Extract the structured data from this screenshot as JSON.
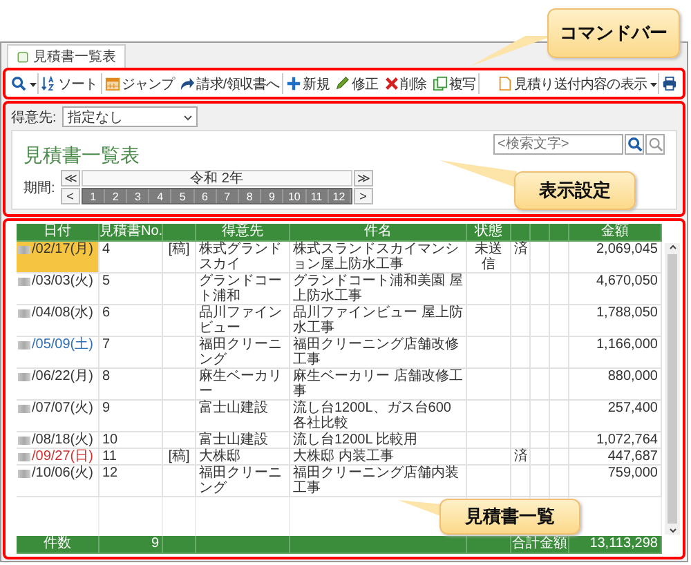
{
  "tab": {
    "label": "見積書一覧表",
    "selected": true
  },
  "toolbar": {
    "items": [
      {
        "kind": "search"
      },
      {
        "kind": "sort",
        "label": "ソート"
      },
      {
        "kind": "jump",
        "label": "ジャンプ"
      },
      {
        "kind": "forward",
        "label": "請求/領収書へ"
      },
      {
        "kind": "new",
        "label": "新規"
      },
      {
        "kind": "edit",
        "label": "修正"
      },
      {
        "kind": "delete",
        "label": "削除"
      },
      {
        "kind": "copy",
        "label": "複写"
      }
    ],
    "preview": {
      "label": "見積り送付内容の表示"
    }
  },
  "filter": {
    "label": "得意先:",
    "value": "指定なし"
  },
  "title": "見積書一覧表",
  "search": {
    "placeholder": "<検索文字>"
  },
  "period": {
    "label": "期間:",
    "first": "≪",
    "last": "≫",
    "prev": "<",
    "next": ">",
    "year": "令和 2年",
    "months": [
      {
        "label": "1",
        "selected": false
      },
      {
        "label": "2",
        "selected": false
      },
      {
        "label": "3",
        "selected": false
      },
      {
        "label": "4",
        "selected": false
      },
      {
        "label": "5",
        "selected": false
      },
      {
        "label": "6",
        "selected": false
      },
      {
        "label": "7",
        "selected": false
      },
      {
        "label": "8",
        "selected": false
      },
      {
        "label": "9",
        "selected": false
      },
      {
        "label": "10",
        "selected": false
      },
      {
        "label": "11",
        "selected": false
      },
      {
        "label": "12",
        "selected": false
      }
    ]
  },
  "table": {
    "columns": [
      "日付",
      "見積書No.",
      null,
      "得意先",
      "件名",
      "状態",
      null,
      null,
      null,
      "金額"
    ],
    "rows": [
      {
        "date": "/02/17(月)",
        "color": "#333333",
        "selected": true,
        "no": "4",
        "mark": "[稿]",
        "client": "株式グランドスカイ",
        "subject": "株式スランドスカイマンション屋上防水工事",
        "status": "未送信",
        "c7": "済",
        "amount": "2,069,045"
      },
      {
        "date": "/03/03(火)",
        "color": "#333333",
        "selected": false,
        "no": "5",
        "client": "グランドコート浦和",
        "subject": "グランドコート浦和美園 屋上防水工事",
        "amount": "4,670,050"
      },
      {
        "date": "/04/08(水)",
        "color": "#333333",
        "selected": false,
        "no": "6",
        "client": "品川ファインビュー",
        "subject": "品川ファインビュー 屋上防水工事",
        "amount": "1,788,050"
      },
      {
        "date": "/05/09(土)",
        "color": "#2f6db5",
        "selected": false,
        "no": "7",
        "client": "福田クリーニング",
        "subject": "福田クリーニング店舗改修工事",
        "amount": "1,166,000"
      },
      {
        "date": "/06/22(月)",
        "color": "#333333",
        "selected": false,
        "no": "8",
        "client": "麻生ベーカリー",
        "subject": "麻生ベーカリー 店舗改修工事",
        "amount": "880,000"
      },
      {
        "date": "/07/07(火)",
        "color": "#333333",
        "selected": false,
        "no": "9",
        "client": "富士山建設",
        "subject": "流し台1200L、ガス台600 各社比較",
        "amount": "257,400"
      },
      {
        "date": "/08/18(火)",
        "color": "#333333",
        "selected": false,
        "no": "10",
        "client": "富士山建設",
        "subject": "流し台1200L 比較用",
        "amount": "1,072,764"
      },
      {
        "date": "/09/27(日)",
        "color": "#d23030",
        "selected": false,
        "no": "11",
        "mark": "[稿]",
        "client": "大株邸",
        "subject": "大株邸 内装工事",
        "c7": "済",
        "amount": "447,687"
      },
      {
        "date": "/10/06(火)",
        "color": "#333333",
        "selected": false,
        "no": "12",
        "client": "福田クリーニング",
        "subject": "福田クリーニング店舗内装工事",
        "amount": "759,000"
      }
    ],
    "footer": {
      "count_label": "件数",
      "count": "9",
      "total_label": "合計金額",
      "total": "13,113,298"
    }
  },
  "annotations": [
    {
      "text": "コマンドバー"
    },
    {
      "text": "表示設定"
    },
    {
      "text": "見積書一覧"
    }
  ]
}
